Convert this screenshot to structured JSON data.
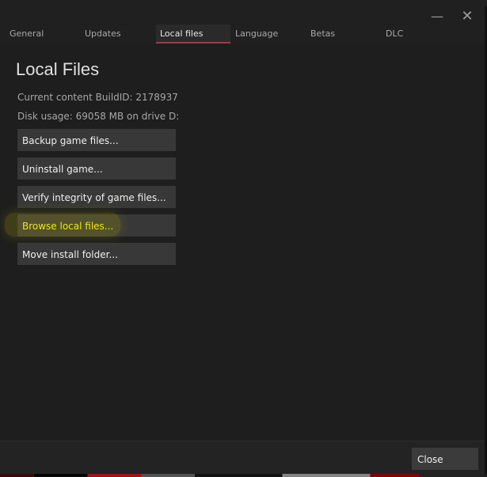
{
  "window": {
    "minimize_glyph": "—",
    "close_glyph": "✕"
  },
  "tabs": [
    {
      "label": "General"
    },
    {
      "label": "Updates"
    },
    {
      "label": "Local files",
      "active": true
    },
    {
      "label": "Language"
    },
    {
      "label": "Betas"
    },
    {
      "label": "DLC"
    }
  ],
  "local_files": {
    "title": "Local Files",
    "build_id_text": "Current content BuildID: 2178937",
    "disk_usage_text": "Disk usage: 69058 MB on drive D:",
    "buttons": {
      "backup": "Backup game files...",
      "uninstall": "Uninstall game...",
      "verify": "Verify integrity of game files...",
      "browse": "Browse local files...",
      "move": "Move install folder..."
    }
  },
  "footer": {
    "close_label": "Close"
  },
  "colors": {
    "background": "#1e1e1e",
    "active_tab_indicator": "#a1394f",
    "highlight_text": "#f4f01d"
  }
}
